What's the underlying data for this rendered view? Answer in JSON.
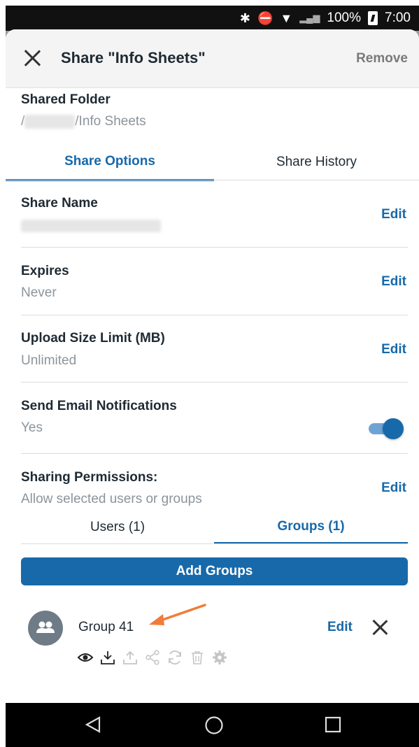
{
  "status_bar": {
    "battery": "100%",
    "time": "7:00"
  },
  "header": {
    "title": "Share \"Info Sheets\"",
    "remove_label": "Remove"
  },
  "shared_folder": {
    "label": "Shared Folder",
    "path_prefix": "/",
    "path_suffix": "/Info Sheets"
  },
  "tabs": [
    {
      "label": "Share Options",
      "active": true
    },
    {
      "label": "Share History",
      "active": false
    }
  ],
  "settings": {
    "share_name": {
      "label": "Share Name",
      "edit": "Edit"
    },
    "expires": {
      "label": "Expires",
      "value": "Never",
      "edit": "Edit"
    },
    "upload_limit": {
      "label": "Upload Size Limit (MB)",
      "value": "Unlimited",
      "edit": "Edit"
    },
    "email_notifications": {
      "label": "Send Email Notifications",
      "value": "Yes",
      "enabled": true
    },
    "sharing_permissions": {
      "label": "Sharing Permissions:",
      "value": "Allow selected users or groups",
      "edit": "Edit"
    }
  },
  "subtabs": [
    {
      "label": "Users (1)",
      "active": false
    },
    {
      "label": "Groups (1)",
      "active": true
    }
  ],
  "add_button": "Add Groups",
  "group_row": {
    "name": "Group 41",
    "edit": "Edit"
  },
  "perm_icons": [
    "view-icon",
    "download-icon",
    "upload-icon",
    "share-icon",
    "sync-icon",
    "delete-icon",
    "settings-icon"
  ],
  "colors": {
    "accent": "#1769aa",
    "annotation_arrow": "#f07c3a"
  }
}
